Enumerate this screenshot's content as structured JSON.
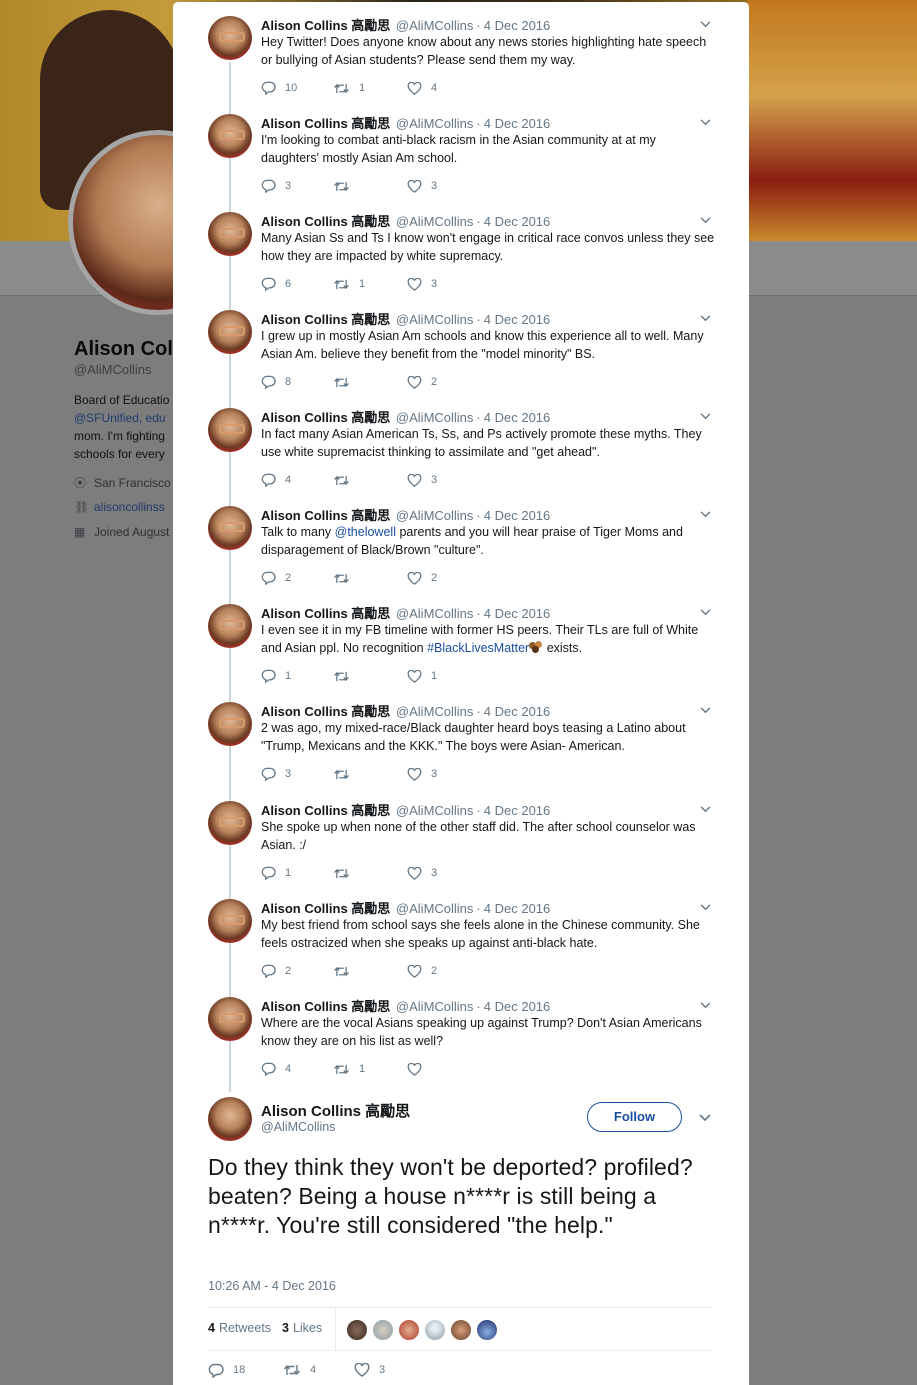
{
  "background_profile": {
    "name": "Alison Coll",
    "handle": "@AliMCollins",
    "bio_lines": [
      "Board of Educatio",
      "@SFUnified, edu",
      "mom. I'm fighting",
      "schools for every"
    ],
    "location": "San Francisco",
    "website": "alisoncollinss",
    "joined": "Joined August"
  },
  "tweets": [
    {
      "name": "Alison Collins 高勵思",
      "handle": "@AliMCollins",
      "date": "4 Dec 2016",
      "text": "Hey Twitter! Does anyone know about any news stories highlighting hate speech or bullying of Asian students? Please send them my way.",
      "replies": "10",
      "retweets": "1",
      "likes": "4"
    },
    {
      "name": "Alison Collins 高勵思",
      "handle": "@AliMCollins",
      "date": "4 Dec 2016",
      "text": "I'm looking to combat anti-black racism in the Asian community at at my daughters' mostly Asian Am school.",
      "replies": "3",
      "retweets": "",
      "likes": "3"
    },
    {
      "name": "Alison Collins 高勵思",
      "handle": "@AliMCollins",
      "date": "4 Dec 2016",
      "text": "Many Asian Ss and Ts I know won't engage in critical race convos unless they see how they are impacted by white supremacy.",
      "replies": "6",
      "retweets": "1",
      "likes": "3"
    },
    {
      "name": "Alison Collins 高勵思",
      "handle": "@AliMCollins",
      "date": "4 Dec 2016",
      "text": "I grew up in mostly Asian Am schools and know this experience all to well. Many Asian Am. believe they benefit from the \"model minority\" BS.",
      "replies": "8",
      "retweets": "",
      "likes": "2"
    },
    {
      "name": "Alison Collins 高勵思",
      "handle": "@AliMCollins",
      "date": "4 Dec 2016",
      "text": "In fact many Asian American Ts, Ss, and Ps actively promote these myths. They use white supremacist thinking to assimilate and \"get ahead\".",
      "replies": "4",
      "retweets": "",
      "likes": "3"
    },
    {
      "name": "Alison Collins 高勵思",
      "handle": "@AliMCollins",
      "date": "4 Dec 2016",
      "text_before": "Talk to many ",
      "mention": "@thelowell",
      "text_after": " parents and you will hear praise of Tiger Moms and disparagement of Black/Brown \"culture\".",
      "replies": "2",
      "retweets": "",
      "likes": "2"
    },
    {
      "name": "Alison Collins 高勵思",
      "handle": "@AliMCollins",
      "date": "4 Dec 2016",
      "text_before": "I even see it in my FB timeline with former HS peers. Their TLs are full of White and Asian ppl. No recognition ",
      "hashtag": "#BlackLivesMatter",
      "text_after": " exists.",
      "replies": "1",
      "retweets": "",
      "likes": "1"
    },
    {
      "name": "Alison Collins 高勵思",
      "handle": "@AliMCollins",
      "date": "4 Dec 2016",
      "text": "2 was ago, my mixed-race/Black daughter heard boys teasing a Latino about \"Trump, Mexicans and the KKK.\" The boys were Asian- American.",
      "replies": "3",
      "retweets": "",
      "likes": "3"
    },
    {
      "name": "Alison Collins 高勵思",
      "handle": "@AliMCollins",
      "date": "4 Dec 2016",
      "text": "She spoke up when none of the other staff did. The after school counselor was Asian. :/",
      "replies": "1",
      "retweets": "",
      "likes": "3"
    },
    {
      "name": "Alison Collins 高勵思",
      "handle": "@AliMCollins",
      "date": "4 Dec 2016",
      "text": "My best friend from school says she feels alone in the Chinese community. She feels ostracized when she speaks up against anti-black hate.",
      "replies": "2",
      "retweets": "",
      "likes": "2"
    },
    {
      "name": "Alison Collins 高勵思",
      "handle": "@AliMCollins",
      "date": "4 Dec 2016",
      "text": "Where are the vocal Asians speaking up against Trump? Don't Asian Americans know they are on his list as well?",
      "replies": "4",
      "retweets": "1",
      "likes": ""
    }
  ],
  "main_tweet": {
    "name": "Alison Collins 高勵思",
    "handle": "@AliMCollins",
    "follow_label": "Follow",
    "text": "Do they think they won't be deported? profiled? beaten? Being a house n****r is still being a n****r. You're still considered \"the help.\"",
    "timestamp": "10:26 AM - 4 Dec 2016",
    "retweets_count": "4",
    "retweets_label": "Retweets",
    "likes_count": "3",
    "likes_label": "Likes",
    "replies": "18",
    "retweets": "4",
    "likes": "3"
  },
  "colors": {
    "link": "#1b4fa0",
    "muted": "#657786",
    "text": "#14171a",
    "divider": "#e6ecf0"
  },
  "icons": {
    "reply": "reply-icon",
    "retweet": "retweet-icon",
    "like": "heart-icon",
    "caret": "chevron-down-icon",
    "location": "location-pin-icon",
    "link": "link-icon",
    "calendar": "calendar-icon"
  }
}
